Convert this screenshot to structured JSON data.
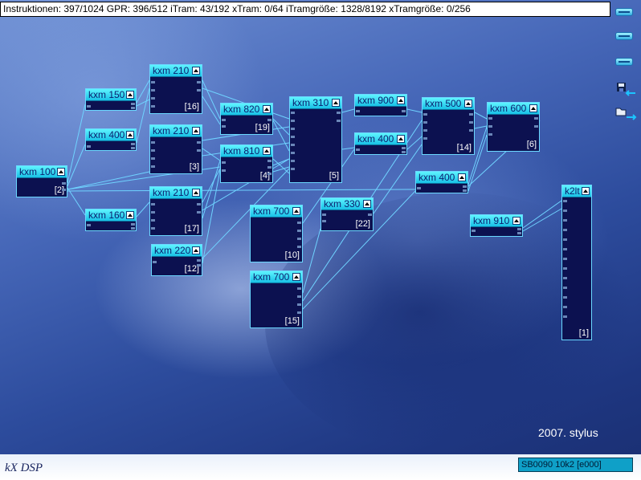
{
  "status": {
    "text": "Instruktionen: 397/1024 GPR: 396/512 iTram: 43/192 xTram: 0/64 iTramgröße: 1328/8192 xTramgröße: 0/256"
  },
  "side_buttons": [
    {
      "icon": "minimize-bar-icon"
    },
    {
      "icon": "minimize-bar-icon"
    },
    {
      "icon": "minimize-bar-icon"
    },
    {
      "icon": "save-arrow-icon"
    },
    {
      "icon": "open-folder-arrow-icon"
    }
  ],
  "plugins": [
    {
      "id": "kxm100",
      "title": "kxm 100",
      "number": "[2]"
    },
    {
      "id": "kxm150",
      "title": "kxm 150",
      "number": ""
    },
    {
      "id": "kxm400a",
      "title": "kxm 400",
      "number": ""
    },
    {
      "id": "kxm160",
      "title": "kxm 160",
      "number": ""
    },
    {
      "id": "kxm210a",
      "title": "kxm 210",
      "number": "[16]"
    },
    {
      "id": "kxm210b",
      "title": "kxm 210",
      "number": "[3]"
    },
    {
      "id": "kxm210c",
      "title": "kxm 210",
      "number": "[17]"
    },
    {
      "id": "kxm220",
      "title": "kxm 220",
      "number": "[12]"
    },
    {
      "id": "kxm820",
      "title": "kxm 820",
      "number": "[19]"
    },
    {
      "id": "kxm810",
      "title": "kxm 810",
      "number": "[4]"
    },
    {
      "id": "kxm310",
      "title": "kxm 310",
      "number": "[5]"
    },
    {
      "id": "kxm900",
      "title": "kxm 900",
      "number": ""
    },
    {
      "id": "kxm400b",
      "title": "kxm 400",
      "number": ""
    },
    {
      "id": "kxm700a",
      "title": "kxm 700",
      "number": "[10]"
    },
    {
      "id": "kxm700b",
      "title": "kxm 700",
      "number": "[15]"
    },
    {
      "id": "kxm330",
      "title": "kxm 330",
      "number": "[22]"
    },
    {
      "id": "kxm500",
      "title": "kxm 500",
      "number": "[14]"
    },
    {
      "id": "kxm400c",
      "title": "kxm 400",
      "number": ""
    },
    {
      "id": "kxm600",
      "title": "kxm 600",
      "number": "[6]"
    },
    {
      "id": "kxm910",
      "title": "kxm 910",
      "number": ""
    },
    {
      "id": "k2lt",
      "title": "k2lt",
      "number": "[1]"
    }
  ],
  "signature": "2007. stylus",
  "footer": {
    "logo": "kX DSP",
    "device": "SB0090 10k2 [e000]"
  },
  "colors": {
    "title_bar": "#19c1e6",
    "plugin_body": "#0c1150",
    "wire": "#6fd3ff"
  }
}
